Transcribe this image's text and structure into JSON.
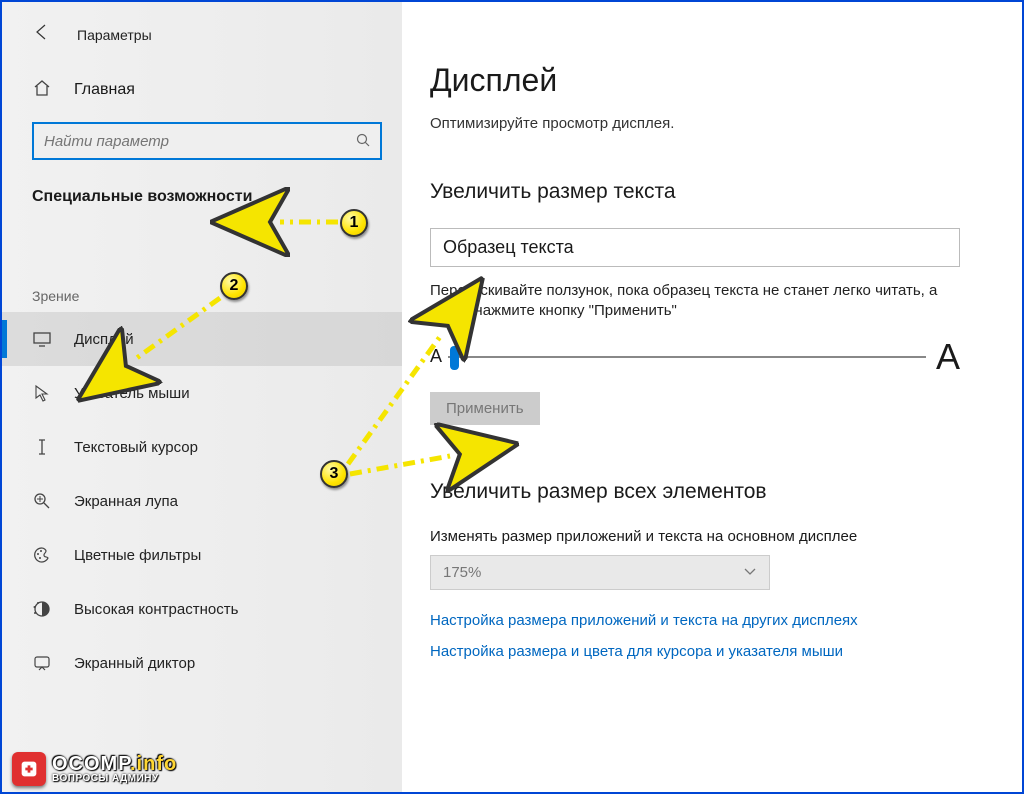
{
  "header": {
    "settings_title": "Параметры",
    "home_label": "Главная"
  },
  "search": {
    "placeholder": "Найти параметр"
  },
  "sidebar": {
    "category": "Специальные возможности",
    "group": "Зрение",
    "items": [
      {
        "label": "Дисплей",
        "icon": "monitor-icon",
        "selected": true
      },
      {
        "label": "Указатель мыши",
        "icon": "pointer-icon",
        "selected": false
      },
      {
        "label": "Текстовый курсор",
        "icon": "text-cursor-icon",
        "selected": false
      },
      {
        "label": "Экранная лупа",
        "icon": "magnifier-icon",
        "selected": false
      },
      {
        "label": "Цветные фильтры",
        "icon": "palette-icon",
        "selected": false
      },
      {
        "label": "Высокая контрастность",
        "icon": "contrast-icon",
        "selected": false
      },
      {
        "label": "Экранный диктор",
        "icon": "narrator-icon",
        "selected": false
      }
    ]
  },
  "main": {
    "title": "Дисплей",
    "subtitle": "Оптимизируйте просмотр дисплея.",
    "text_size_heading": "Увеличить размер текста",
    "sample_text": "Образец текста",
    "slider_desc": "Перетаскивайте ползунок, пока образец текста не станет легко читать, а затем нажмите кнопку \"Применить\"",
    "small_a": "A",
    "big_a": "A",
    "apply_label": "Применить",
    "scale_heading": "Увеличить размер всех элементов",
    "scale_label": "Изменять размер приложений и текста на основном дисплее",
    "scale_value": "175%",
    "link1": "Настройка размера приложений и текста на других дисплеях",
    "link2": "Настройка размера и цвета для курсора и указателя мыши"
  },
  "annotations": {
    "m1": "1",
    "m2": "2",
    "m3": "3"
  },
  "watermark": {
    "main_a": "OCOMP",
    "main_b": ".info",
    "sub": "ВОПРОСЫ АДМИНУ"
  }
}
